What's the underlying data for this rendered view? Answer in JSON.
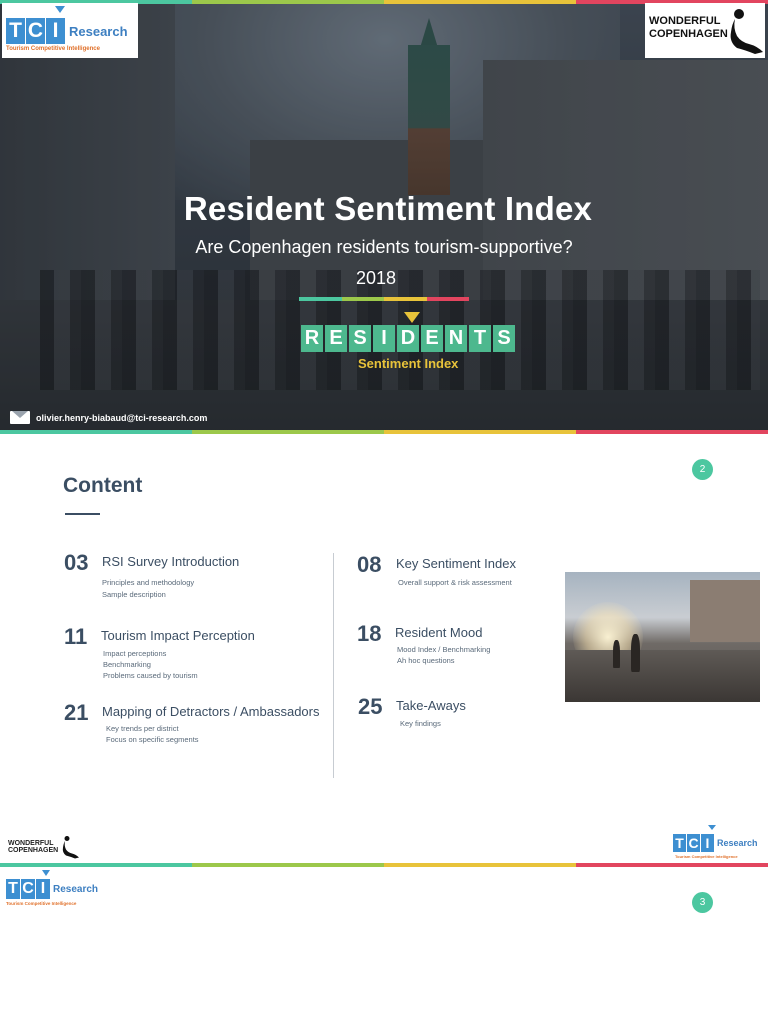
{
  "colors": {
    "stripe": [
      "#4cc7a0",
      "#9cc84b",
      "#e8c33a",
      "#e2455f"
    ],
    "accent_green": "#4db88e",
    "accent_yellow": "#e8c33a",
    "navy": "#3b4e63",
    "page_badge": "#4cc7a0"
  },
  "tci_logo": {
    "letters": [
      "T",
      "C",
      "I"
    ],
    "word": "Research",
    "tagline": "Tourism Competitive Intelligence"
  },
  "wonderful_logo": {
    "line1": "WONDERFUL",
    "line2": "COPENHAGEN"
  },
  "cover": {
    "title": "Resident Sentiment Index",
    "subtitle": "Are Copenhagen residents tourism-supportive?",
    "year": "2018",
    "residents_letters": [
      "R",
      "E",
      "S",
      "I",
      "D",
      "E",
      "N",
      "T",
      "S"
    ],
    "residents_sub": "Sentiment Index",
    "email": "olivier.henry-biabaud@tci-research.com"
  },
  "contents": {
    "page_number": "2",
    "title": "Content",
    "left": [
      {
        "num": "03",
        "heading": "RSI Survey Introduction",
        "items": [
          "Principles and methodology",
          "Sample description"
        ]
      },
      {
        "num": "11",
        "heading": "Tourism Impact Perception",
        "items": [
          "Impact perceptions",
          "Benchmarking",
          "Problems caused by tourism"
        ]
      },
      {
        "num": "21",
        "heading": "Mapping of Detractors / Ambassadors",
        "items": [
          "Key trends per district",
          "Focus on specific segments"
        ]
      }
    ],
    "right": [
      {
        "num": "08",
        "heading": "Key Sentiment Index",
        "items": [
          "Overall support & risk assessment"
        ]
      },
      {
        "num": "18",
        "heading": "Resident Mood",
        "items": [
          "Mood Index / Benchmarking",
          "Ah hoc questions"
        ]
      },
      {
        "num": "25",
        "heading": "Take-Aways",
        "items": [
          "Key findings"
        ]
      }
    ]
  },
  "slide3": {
    "page_number": "3"
  }
}
